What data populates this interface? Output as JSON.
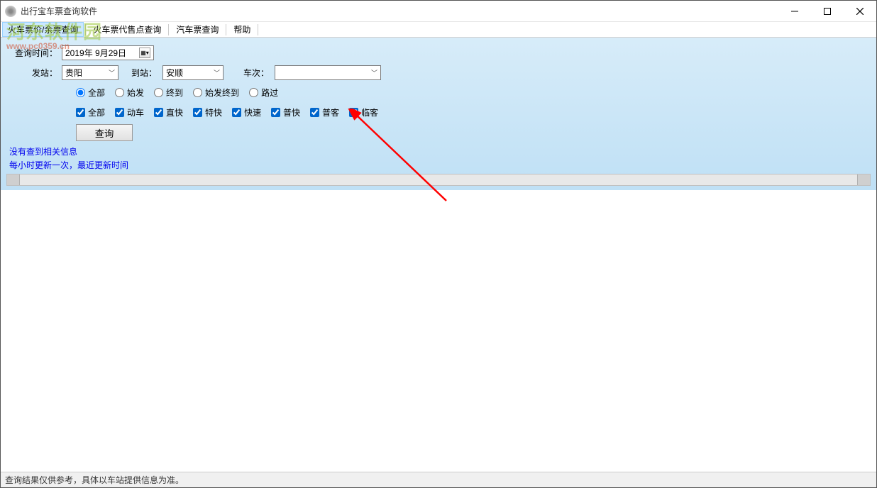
{
  "window": {
    "title": "出行宝车票查询软件"
  },
  "menus": {
    "ticket_query": "火车票价/余票查询",
    "agent_query": "火车票代售点查询",
    "bus_query": "汽车票查询",
    "help": "帮助"
  },
  "labels": {
    "query_time": "查询时间：",
    "from_station": "发站：",
    "to_station": "到站：",
    "train_no": "车次："
  },
  "fields": {
    "date": "2019年 9月29日",
    "from": "贵阳",
    "to": "安顺",
    "train": ""
  },
  "radios": {
    "all": "全部",
    "start": "始发",
    "end": "终到",
    "start_end": "始发终到",
    "pass": "路过"
  },
  "checks": {
    "all": "全部",
    "dongche": "动车",
    "zhikuai": "直快",
    "tekuai": "特快",
    "kuaisu": "快速",
    "pukuai": "普快",
    "puke": "普客",
    "linke": "临客"
  },
  "buttons": {
    "query": "查询"
  },
  "messages": {
    "no_results": "没有查到相关信息",
    "update_info": "每小时更新一次，最近更新时间"
  },
  "statusbar": "查询结果仅供参考，具体以车站提供信息为准。",
  "watermark": {
    "cn": "河东软件园",
    "url": "www.pc0359.cn"
  }
}
